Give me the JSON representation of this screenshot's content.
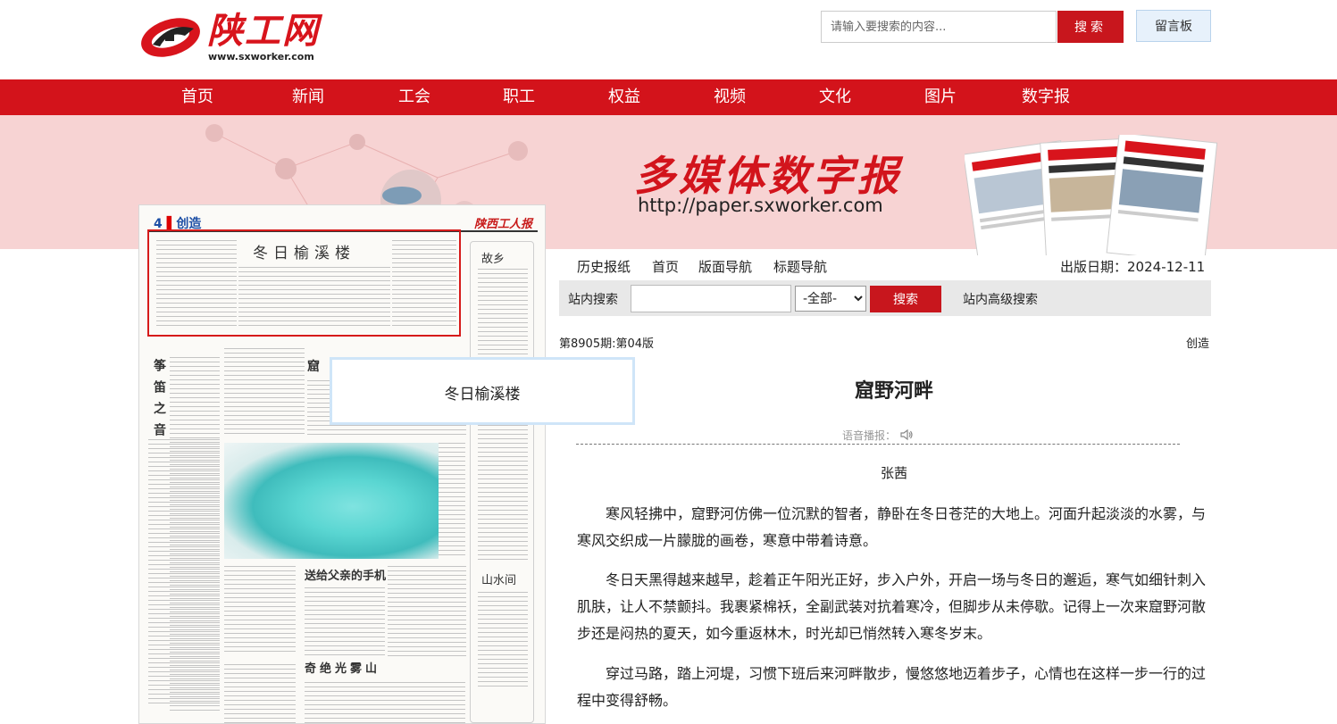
{
  "header": {
    "logo_text": "陕工网",
    "logo_url": "www.sxworker.com",
    "search_placeholder": "请输入要搜索的内容...",
    "search_label": "搜索",
    "message_label": "留言板"
  },
  "nav": {
    "items": [
      "首页",
      "新闻",
      "工会",
      "职工",
      "权益",
      "视频",
      "文化",
      "图片",
      "数字报"
    ]
  },
  "banner": {
    "title": "多媒体数字报",
    "url": "http://paper.sxworker.com",
    "paper_brand": "陕西工人报"
  },
  "paper": {
    "page_label": "4",
    "page_section": "创造",
    "brand": "陕西工人报",
    "highlighted_article": "冬日榆溪楼",
    "side_title": "故乡",
    "vertical_title": "筝笛之音",
    "side_title_2": "山水间",
    "sub_article_1": "送给父亲的手机",
    "sub_article_2": "奇绝光雾山",
    "partial_title": "窟"
  },
  "tooltip": {
    "text": "冬日榆溪楼"
  },
  "subnav": {
    "items": [
      "历史报纸",
      "首页",
      "版面导航",
      "标题导航"
    ],
    "pubdate_label": "出版日期：",
    "pubdate": "2024-12-11"
  },
  "site_search": {
    "label": "站内搜索",
    "select_value": "-全部-",
    "button": "搜索",
    "advanced": "站内高级搜索"
  },
  "article": {
    "issue": "第8905期:第04版",
    "section": "创造",
    "title": "窟野河畔",
    "tts_label": "语音播报：",
    "author": "张茜",
    "paragraphs": [
      "寒风轻拂中，窟野河仿佛一位沉默的智者，静卧在冬日苍茫的大地上。河面升起淡淡的水雾，与寒风交织成一片朦胧的画卷，寒意中带着诗意。",
      "冬日天黑得越来越早，趁着正午阳光正好，步入户外，开启一场与冬日的邂逅，寒气如细针刺入肌肤，让人不禁颤抖。我裹紧棉袄，全副武装对抗着寒冷，但脚步从未停歇。记得上一次来窟野河散步还是闷热的夏天，如今重返林木，时光却已悄然转入寒冬岁末。",
      "穿过马路，踏上河堤，习惯下班后来河畔散步，慢悠悠地迈着步子，心情也在这样一步一行的过程中变得舒畅。"
    ]
  },
  "colors": {
    "brand_red": "#d3131b",
    "banner_pink": "#f7d3d3"
  }
}
